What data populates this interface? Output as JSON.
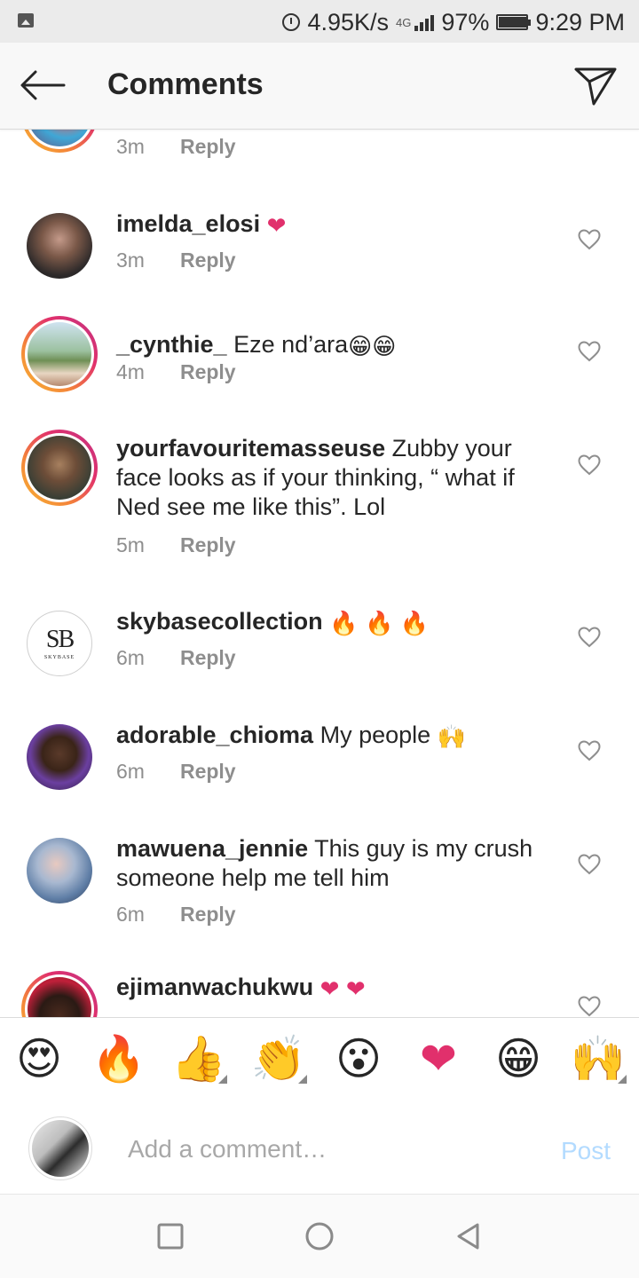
{
  "status_bar": {
    "net_speed": "4.95K/s",
    "net_type": "4G",
    "battery": "97%",
    "battery_level": 97,
    "time": "9:29 PM",
    "icons": [
      "image-icon",
      "alarm-icon",
      "signal-icon",
      "battery-icon"
    ]
  },
  "header": {
    "title": "Comments",
    "back_icon": "arrow-left-icon",
    "share_icon": "paper-plane-icon"
  },
  "comments": [
    {
      "username": "",
      "text": "",
      "time": "3m",
      "reply": "Reply",
      "emojis": []
    },
    {
      "username": "imelda_elosi",
      "text": "",
      "time": "3m",
      "reply": "Reply",
      "emojis": [
        "❤"
      ]
    },
    {
      "username": "_cynthie_",
      "text": "Eze nd’ara",
      "time": "4m",
      "reply": "Reply",
      "emojis": [
        "😁",
        "😁"
      ]
    },
    {
      "username": "yourfavouritemasseuse",
      "text": "Zubby your face looks as if your thinking, “ what if Ned see me like this”. Lol",
      "time": "5m",
      "reply": "Reply",
      "emojis": []
    },
    {
      "username": "skybasecollection",
      "text": "",
      "time": "6m",
      "reply": "Reply",
      "emojis": [
        "🔥",
        "🔥",
        "🔥"
      ]
    },
    {
      "username": "adorable_chioma",
      "text": "My people",
      "time": "6m",
      "reply": "Reply",
      "emojis": [
        "🙌"
      ]
    },
    {
      "username": "mawuena_jennie",
      "text": "This guy is my crush someone help me tell him",
      "time": "6m",
      "reply": "Reply",
      "emojis": []
    },
    {
      "username": "ejimanwachukwu",
      "text": "",
      "time": "",
      "reply": "",
      "emojis": [
        "❤",
        "❤"
      ]
    }
  ],
  "skybase_logo": {
    "mark": "SB",
    "caption": "SKYBASE"
  },
  "emoji_bar": [
    "😍",
    "🔥",
    "👍",
    "👏",
    "😮",
    "❤",
    "😁",
    "🙌"
  ],
  "compose": {
    "placeholder": "Add a comment…",
    "post_label": "Post"
  },
  "nav_bar": [
    "recents-square-icon",
    "home-circle-icon",
    "back-triangle-icon"
  ],
  "colors": {
    "accent_heart": "#e1306c",
    "post_disabled": "#b3dbff",
    "meta_gray": "#8e8e8e"
  }
}
